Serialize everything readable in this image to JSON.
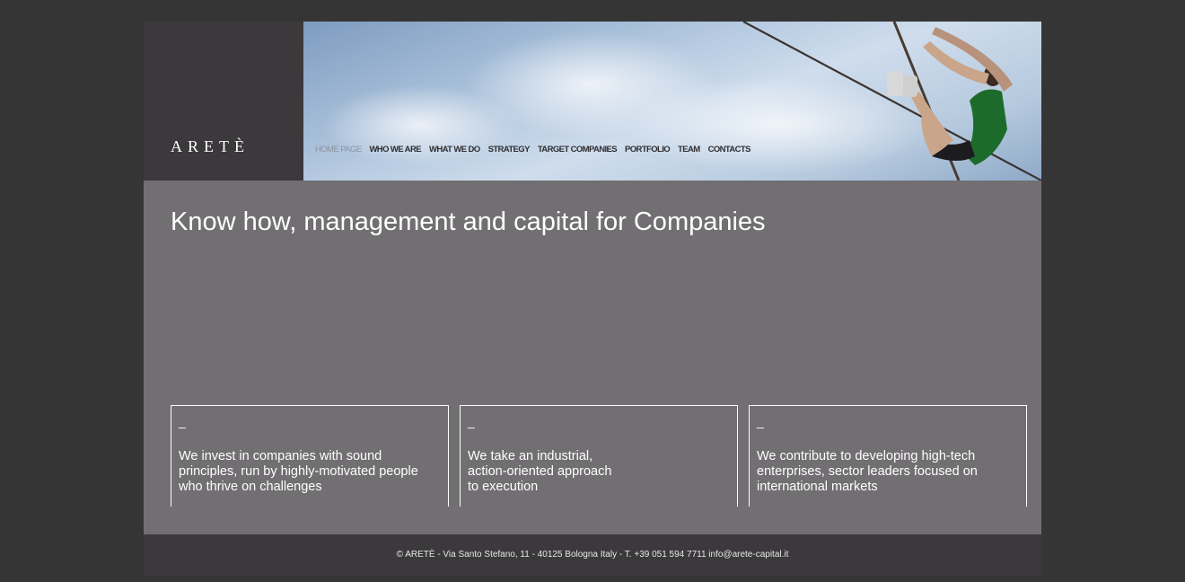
{
  "brand": {
    "logo_text": "ARETÈ"
  },
  "nav": {
    "items": [
      {
        "label": "HOME PAGE",
        "active": true
      },
      {
        "label": "WHO WE ARE",
        "active": false
      },
      {
        "label": "WHAT WE DO",
        "active": false
      },
      {
        "label": "STRATEGY",
        "active": false
      },
      {
        "label": "TARGET COMPANIES",
        "active": false
      },
      {
        "label": "PORTFOLIO",
        "active": false
      },
      {
        "label": "TEAM",
        "active": false
      },
      {
        "label": "CONTACTS",
        "active": false
      }
    ]
  },
  "main": {
    "headline": "Know how, management and capital for Companies",
    "cards": [
      {
        "dash": "_",
        "text": "We invest in companies with sound\nprinciples, run by highly-motivated people\nwho thrive on challenges"
      },
      {
        "dash": "_",
        "text": "We take an industrial,\naction-oriented approach\nto execution"
      },
      {
        "dash": "_",
        "text": "We contribute to developing high-tech\nenterprises, sector leaders focused on\ninternational markets"
      }
    ]
  },
  "footer": {
    "text": "© ARETÈ - Via Santo Stefano, 11 - 40125 Bologna Italy - T. +39 051 594 7711 info@arete-capital.it"
  },
  "colors": {
    "background": "#363536",
    "logo_block": "#3b393b",
    "main_panel": "#716f71",
    "nav_active": "#8c94a0",
    "nav_text": "#2e2e32"
  },
  "icons": {
    "hero": "climber-on-rope-photo"
  }
}
